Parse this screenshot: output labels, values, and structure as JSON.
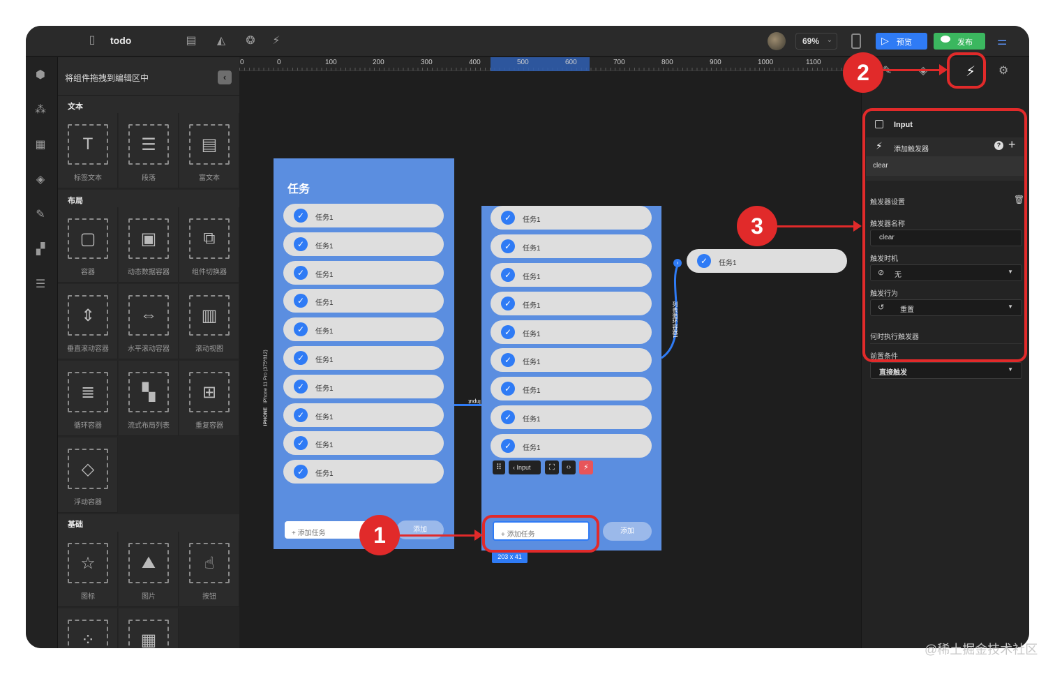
{
  "app": {
    "title": "todo",
    "zoom": "69%",
    "preview_label": "预览",
    "publish_label": "发布"
  },
  "components_panel": {
    "title": "将组件拖拽到编辑区中",
    "sections": [
      {
        "name": "文本",
        "items": [
          "标签文本",
          "段落",
          "富文本"
        ]
      },
      {
        "name": "布局",
        "items": [
          "容器",
          "动态数据容器",
          "组件切换器",
          "垂直滚动容器",
          "水平滚动容器",
          "滚动视图",
          "循环容器",
          "流式布局列表",
          "重复容器",
          "浮动容器"
        ]
      },
      {
        "name": "基础",
        "items": [
          "图标",
          "图片",
          "按钮",
          "",
          ""
        ]
      }
    ]
  },
  "ruler": {
    "labels": [
      "0",
      "0",
      "100",
      "200",
      "300",
      "400",
      "500",
      "600",
      "700",
      "800",
      "900",
      "1000",
      "1100"
    ]
  },
  "canvas": {
    "device_label": "IPHONE",
    "device_model": "iPhone 11 Pro (375*812)",
    "panel_a": {
      "title": "任务",
      "tasks": [
        "任务1",
        "任务1",
        "任务1",
        "任务1",
        "任务1",
        "任务1",
        "任务1",
        "任务1",
        "任务1",
        "任务1"
      ],
      "input_placeholder": "+ 添加任务",
      "add_label": "添加"
    },
    "panel_b": {
      "tasks": [
        "任务1",
        "任务1",
        "任务1",
        "任务1",
        "任务1",
        "任务1",
        "任务1",
        "任务1",
        "任务1"
      ],
      "input_placeholder": "+ 添加任务",
      "add_label": "添加",
      "size_badge": "203 x 41"
    },
    "toolbar": {
      "breadcrumb": "Input"
    },
    "floating_task": "任务1",
    "connector_a": "Input",
    "connector_b": "列表循环容器1"
  },
  "annotations": {
    "one": "1",
    "two": "2",
    "three": "3",
    "color": "#e12a2a"
  },
  "right_panel": {
    "component_name": "Input",
    "add_trigger": "添加触发器",
    "trigger_item": "clear",
    "trigger_settings": "触发器设置",
    "trigger_name_label": "触发器名称",
    "trigger_name_value": "clear",
    "trigger_time_label": "触发时机",
    "trigger_time_value": "无",
    "trigger_action_label": "触发行为",
    "trigger_action_value": "重置",
    "when_label": "何时执行触发器",
    "precondition_label": "前置条件",
    "precondition_value": "直接触发"
  },
  "watermark": "@稀土掘金技术社区",
  "colors": {
    "accent": "#2f7bf5",
    "publish": "#3bb75f",
    "panel_blue": "#5b8ee0"
  }
}
